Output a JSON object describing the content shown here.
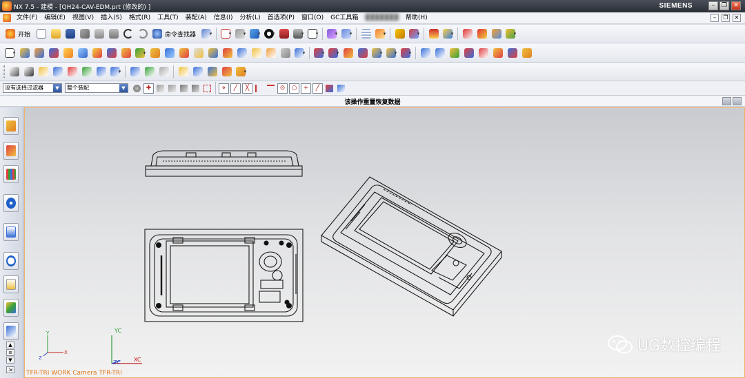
{
  "titlebar": {
    "title": "NX 7.5 - 建模 - [QH24-CAV-EDM.prt  (修改的) ]",
    "brand": "SIEMENS",
    "minimize": "–",
    "restore": "❐",
    "close": "✕"
  },
  "menubar": {
    "items": [
      "文件(F)",
      "编辑(E)",
      "视图(V)",
      "插入(S)",
      "格式(R)",
      "工具(T)",
      "装配(A)",
      "信息(I)",
      "分析(L)",
      "首选项(P)",
      "窗口(O)",
      "GC工具箱",
      "▓▓▓▓▓▓▓",
      "帮助(H)"
    ],
    "mdi_minimize": "–",
    "mdi_restore": "❐",
    "mdi_close": "✕"
  },
  "toolbar": {
    "start_label": "开始",
    "command_finder_label": "命令查找器"
  },
  "selection_bar": {
    "filter_value": "没有选择过滤器",
    "scope_value": "整个装配"
  },
  "status": {
    "message": "该操作重置恢复数据"
  },
  "viewport": {
    "wcs_label": "TFR-TRI WORK Camera TFR-TRI",
    "axis_yc": "YC",
    "axis_xc": "XC",
    "axis_zc": "ZC",
    "axis_y": "Y",
    "axis_x": "X",
    "axis_z": "Z",
    "watermark": "UG数控编程"
  },
  "colors": {
    "title_bg": "#2f333b",
    "viewport_border": "#f0b36a",
    "wcs_label": "#e07818",
    "axis_y": "#2f9b2f",
    "axis_x": "#c42020",
    "axis_z": "#2b46c8"
  },
  "icons": [
    "start-icon",
    "new-icon",
    "open-icon",
    "save-icon",
    "cut-icon",
    "copy-icon",
    "paste-icon",
    "undo-icon",
    "redo-icon",
    "command-finder-icon",
    "select-icon",
    "fit-icon",
    "render-style-icon",
    "shaded-icon",
    "layer-icon",
    "sketch-icon",
    "extrude-icon",
    "revolve-icon",
    "hole-icon",
    "boolean-icon",
    "blend-icon",
    "chamfer-icon",
    "measure-icon",
    "analysis-icon"
  ]
}
